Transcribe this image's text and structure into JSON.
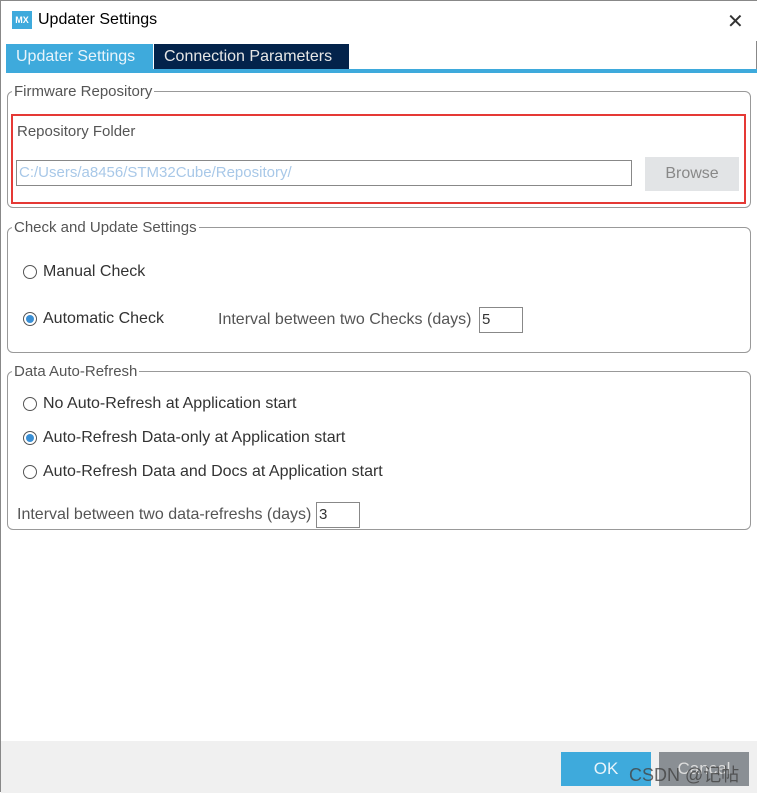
{
  "window": {
    "title": "Updater Settings",
    "logo_text": "MX",
    "close_icon": "close-icon"
  },
  "tabs": [
    {
      "label": "Updater Settings",
      "active": true
    },
    {
      "label": "Connection Parameters",
      "active": false
    }
  ],
  "firmware": {
    "legend": "Firmware Repository",
    "folder_label": "Repository Folder",
    "folder_value": "C:/Users/a8456/STM32Cube/Repository/",
    "browse": "Browse",
    "highlight_color": "#e53935"
  },
  "check": {
    "legend": "Check and Update Settings",
    "manual": "Manual Check",
    "automatic": "Automatic Check",
    "selected": "automatic",
    "interval_label": "Interval between two Checks (days)",
    "interval_value": "5"
  },
  "refresh": {
    "legend": "Data Auto-Refresh",
    "options": [
      "No Auto-Refresh at Application start",
      "Auto-Refresh Data-only at Application start",
      "Auto-Refresh Data and Docs at Application start"
    ],
    "selected_index": 1,
    "interval_label": "Interval between two data-refreshs (days)",
    "interval_value": "3"
  },
  "footer": {
    "ok": "OK",
    "cancel": "Cancel"
  },
  "watermark": "CSDN @记帖"
}
